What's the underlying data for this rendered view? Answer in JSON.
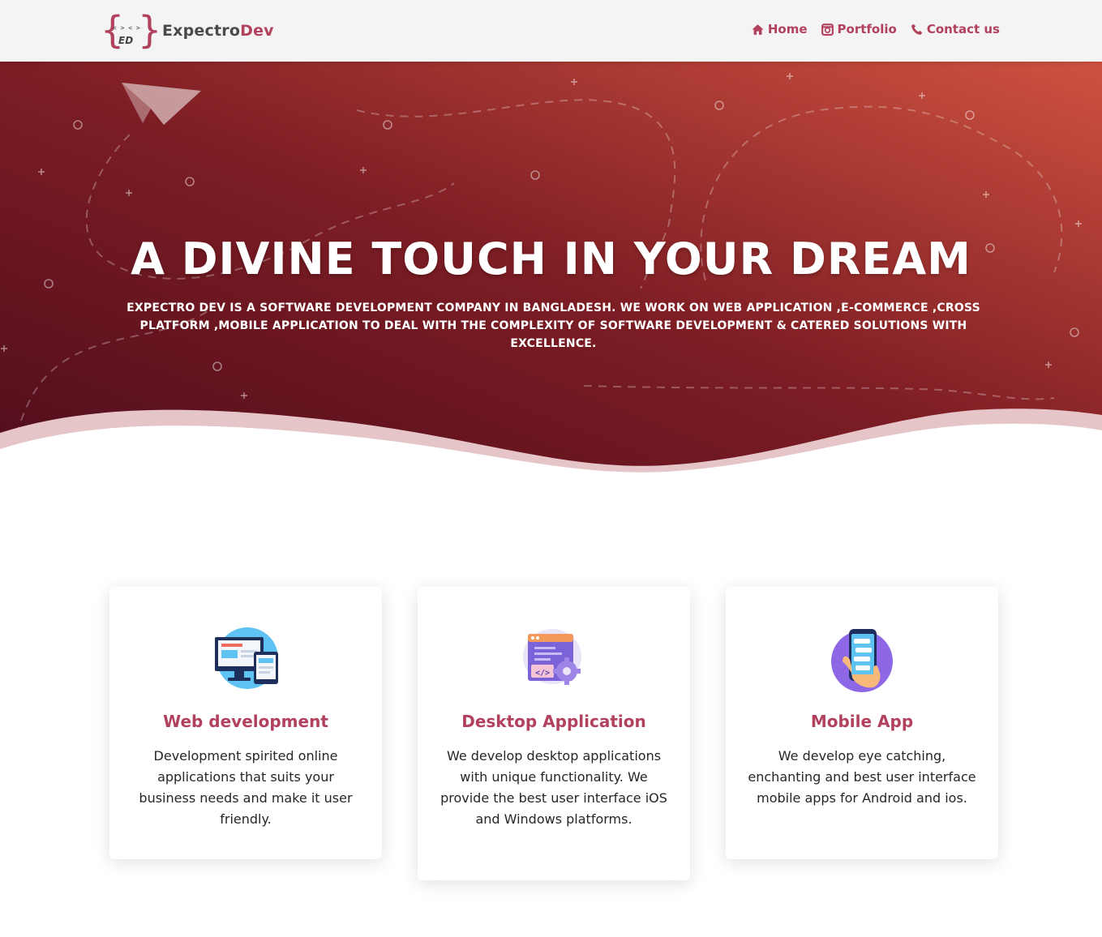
{
  "brand": {
    "name_part1": "Expectro",
    "name_part2": "Dev",
    "logo_text": "< > < >"
  },
  "nav": {
    "items": [
      {
        "label": "Home",
        "icon": "home-icon"
      },
      {
        "label": "Portfolio",
        "icon": "portfolio-icon"
      },
      {
        "label": "Contact us",
        "icon": "phone-icon"
      }
    ]
  },
  "hero": {
    "title": "A DIVINE TOUCH IN YOUR DREAM",
    "subtitle": "EXPECTRO DEV IS A SOFTWARE DEVELOPMENT COMPANY IN BANGLADESH. WE WORK ON WEB APPLICATION ,E-COMMERCE ,CROSS PLATFORM ,MOBILE APPLICATION TO DEAL WITH THE COMPLEXITY OF SOFTWARE DEVELOPMENT & CATERED SOLUTIONS WITH EXCELLENCE.",
    "gradient": [
      "#4e0c1b",
      "#7d1d24",
      "#cf5240"
    ]
  },
  "services": [
    {
      "title": "Web development",
      "text": "Development spirited online applications that suits your business needs and make it user friendly.",
      "icon": "web-development-icon"
    },
    {
      "title": "Desktop Application",
      "text": "We develop desktop applications with unique functionality. We provide the best user interface iOS and Windows platforms.",
      "icon": "desktop-application-icon"
    },
    {
      "title": "Mobile App",
      "text": "We develop eye catching, enchanting and best user interface mobile apps for Android and ios.",
      "icon": "mobile-app-icon"
    }
  ],
  "colors": {
    "accent": "#b2415e",
    "navbar_bg": "#f4f4f4"
  }
}
